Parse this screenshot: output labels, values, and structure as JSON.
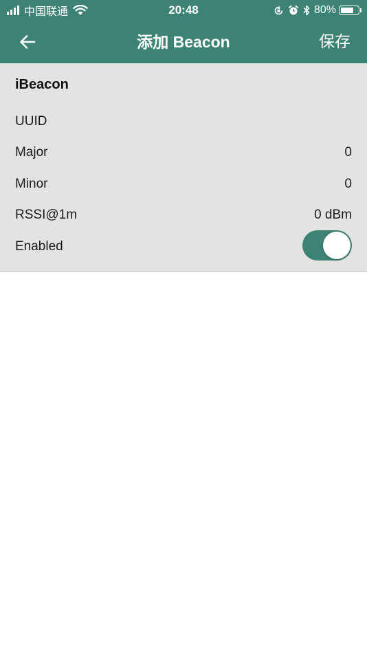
{
  "status_bar": {
    "carrier": "中国联通",
    "time": "20:48",
    "battery_percent": "80%",
    "battery_level": 0.8,
    "icons": [
      "signal-icon",
      "wifi-icon",
      "orientation-lock-icon",
      "alarm-icon",
      "bluetooth-icon",
      "battery-icon"
    ]
  },
  "navbar": {
    "back_icon": "arrow-left-icon",
    "title": "添加 Beacon",
    "save_label": "保存"
  },
  "form": {
    "section_title": "iBeacon",
    "rows": [
      {
        "label": "UUID",
        "value": ""
      },
      {
        "label": "Major",
        "value": "0"
      },
      {
        "label": "Minor",
        "value": "0"
      },
      {
        "label": "RSSI@1m",
        "value": "0 dBm"
      }
    ],
    "enabled": {
      "label": "Enabled",
      "value": true
    }
  },
  "colors": {
    "accent": "#3d8373",
    "panel_bg": "#e3e3e3",
    "page_bg": "#ffffff"
  }
}
